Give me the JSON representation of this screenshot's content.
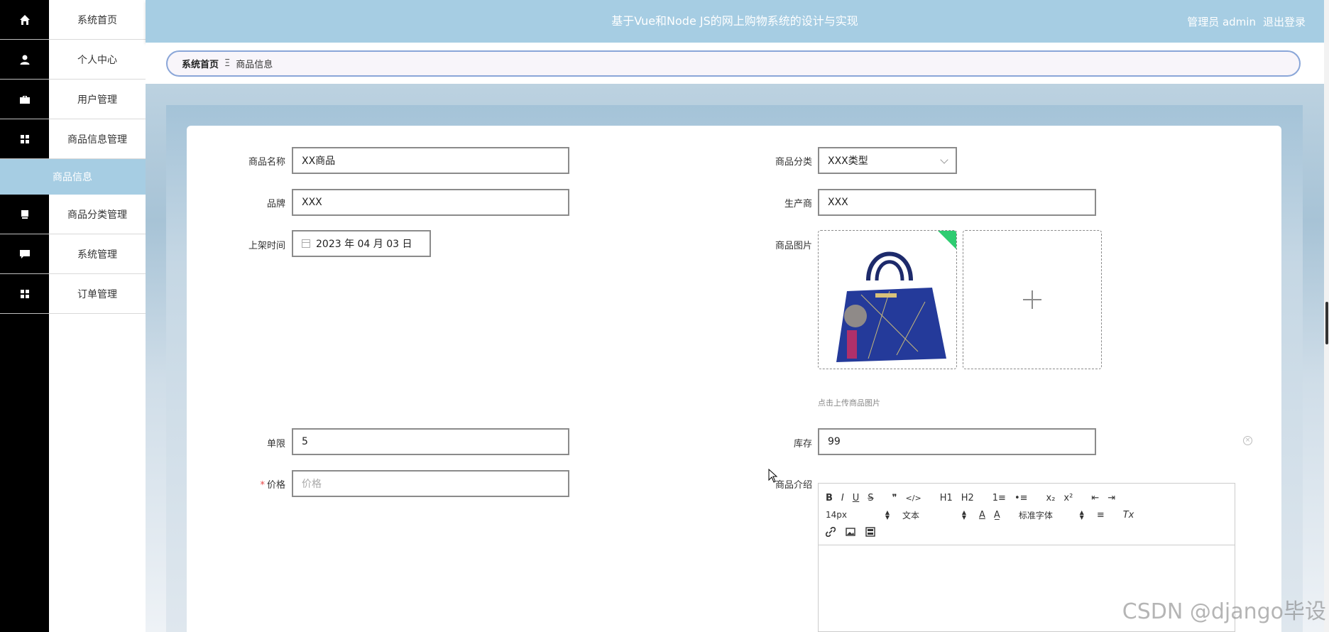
{
  "header": {
    "title": "基于Vue和Node JS的网上购物系统的设计与实现",
    "user_label": "管理员 admin",
    "logout_label": "退出登录"
  },
  "sidebar": {
    "items": [
      {
        "label": "系统首页",
        "icon": "home-icon"
      },
      {
        "label": "个人中心",
        "icon": "user-icon"
      },
      {
        "label": "用户管理",
        "icon": "briefcase-icon"
      },
      {
        "label": "商品信息管理",
        "icon": "grid-icon"
      },
      {
        "label": "商品分类管理",
        "icon": "printer-icon"
      },
      {
        "label": "系统管理",
        "icon": "chat-icon"
      },
      {
        "label": "订单管理",
        "icon": "grid-icon"
      }
    ],
    "active_subitem": "商品信息"
  },
  "breadcrumb": {
    "home": "系统首页",
    "separator": "Ξ",
    "current": "商品信息"
  },
  "form": {
    "name": {
      "label": "商品名称",
      "value": "XX商品"
    },
    "category": {
      "label": "商品分类",
      "value": "XXX类型"
    },
    "brand": {
      "label": "品牌",
      "value": "XXX"
    },
    "manufacturer": {
      "label": "生产商",
      "value": "XXX"
    },
    "shelf_time": {
      "label": "上架时间",
      "value": "2023 年 04 月 03 日"
    },
    "image": {
      "label": "商品图片",
      "hint": "点击上传商品图片"
    },
    "limit": {
      "label": "单限",
      "value": "5"
    },
    "stock": {
      "label": "库存",
      "value": "99"
    },
    "price": {
      "label": "价格",
      "placeholder": "价格",
      "required_mark": "*"
    },
    "intro": {
      "label": "商品介绍"
    }
  },
  "editor": {
    "row1": [
      "B",
      "I",
      "U",
      "S",
      "❞",
      "</>",
      "H1",
      "H2",
      "1≡",
      "•≡",
      "x₂",
      "x²",
      "⇤",
      "⇥"
    ],
    "font_size": "14px",
    "format": "文本",
    "font_family": "标准字体",
    "row2_extra": [
      "A",
      "A̲",
      "≡",
      "Tx"
    ],
    "row3": [
      "link-icon",
      "image-icon",
      "video-icon"
    ]
  },
  "watermark": "CSDN @django毕设",
  "colors": {
    "header_bg": "#a6cde3",
    "active_bg": "#a6cde3",
    "icon_bar": "#000000"
  }
}
